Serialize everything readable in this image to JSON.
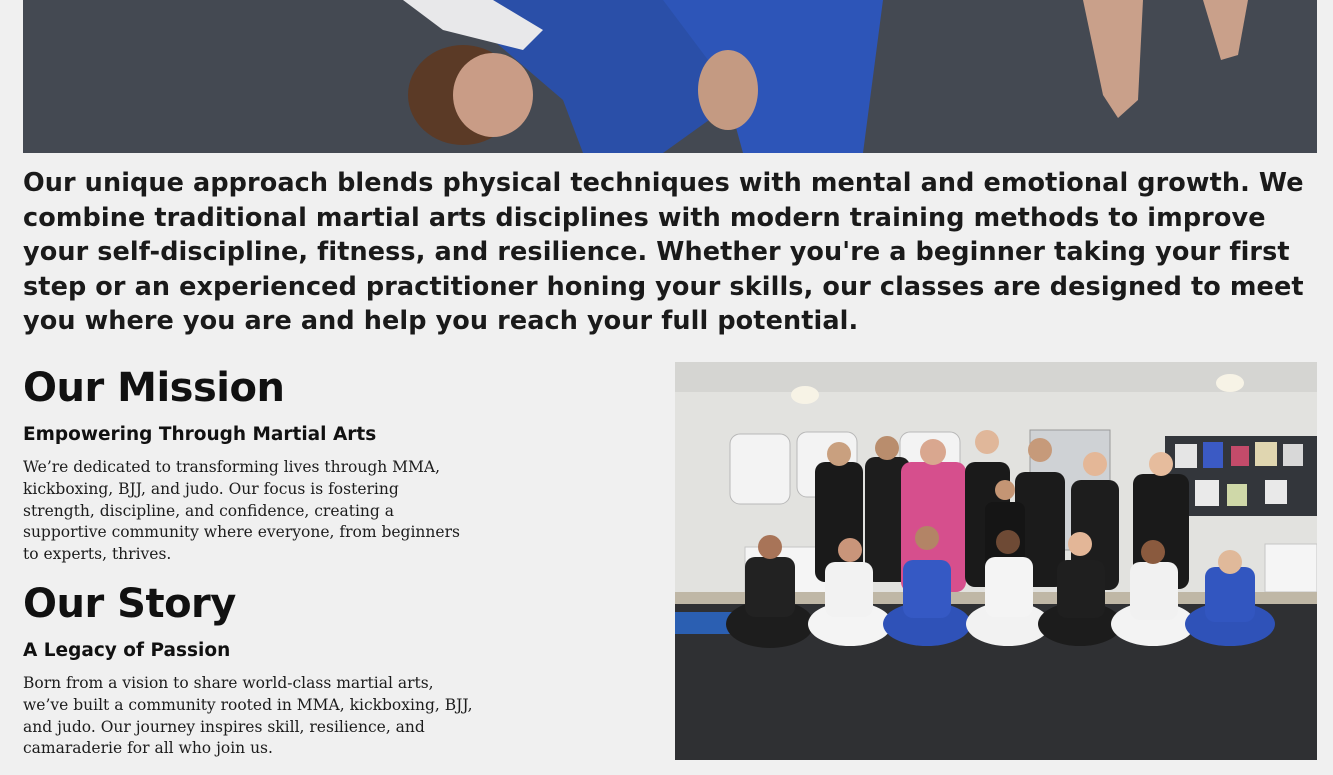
{
  "hero": {
    "image_alt": "Martial arts throw in action"
  },
  "intro": {
    "text": "Our unique approach blends physical techniques with mental and emotional growth. We combine traditional martial arts disciplines with modern training methods to improve your self-discipline, fitness, and resilience. Whether you're a beginner taking your first step or an experienced practitioner honing your skills, our classes are designed to meet you where you are and help you reach your full potential."
  },
  "mission": {
    "title": "Our Mission",
    "subtitle": "Empowering Through Martial Arts",
    "body": "We’re dedicated to transforming lives through MMA, kickboxing, BJJ, and judo. Our focus is fostering strength, discipline, and confidence, creating a supportive community where everyone, from beginners to experts, thrives."
  },
  "story": {
    "title": "Our Story",
    "subtitle": "A Legacy of Passion",
    "body": "Born from a vision to share world-class martial arts, we’ve built a community rooted in MMA, kickboxing, BJJ, and judo. Our journey inspires skill, resilience, and camaraderie for all who join us."
  },
  "group_photo": {
    "image_alt": "Group photo of club members on the mats"
  }
}
